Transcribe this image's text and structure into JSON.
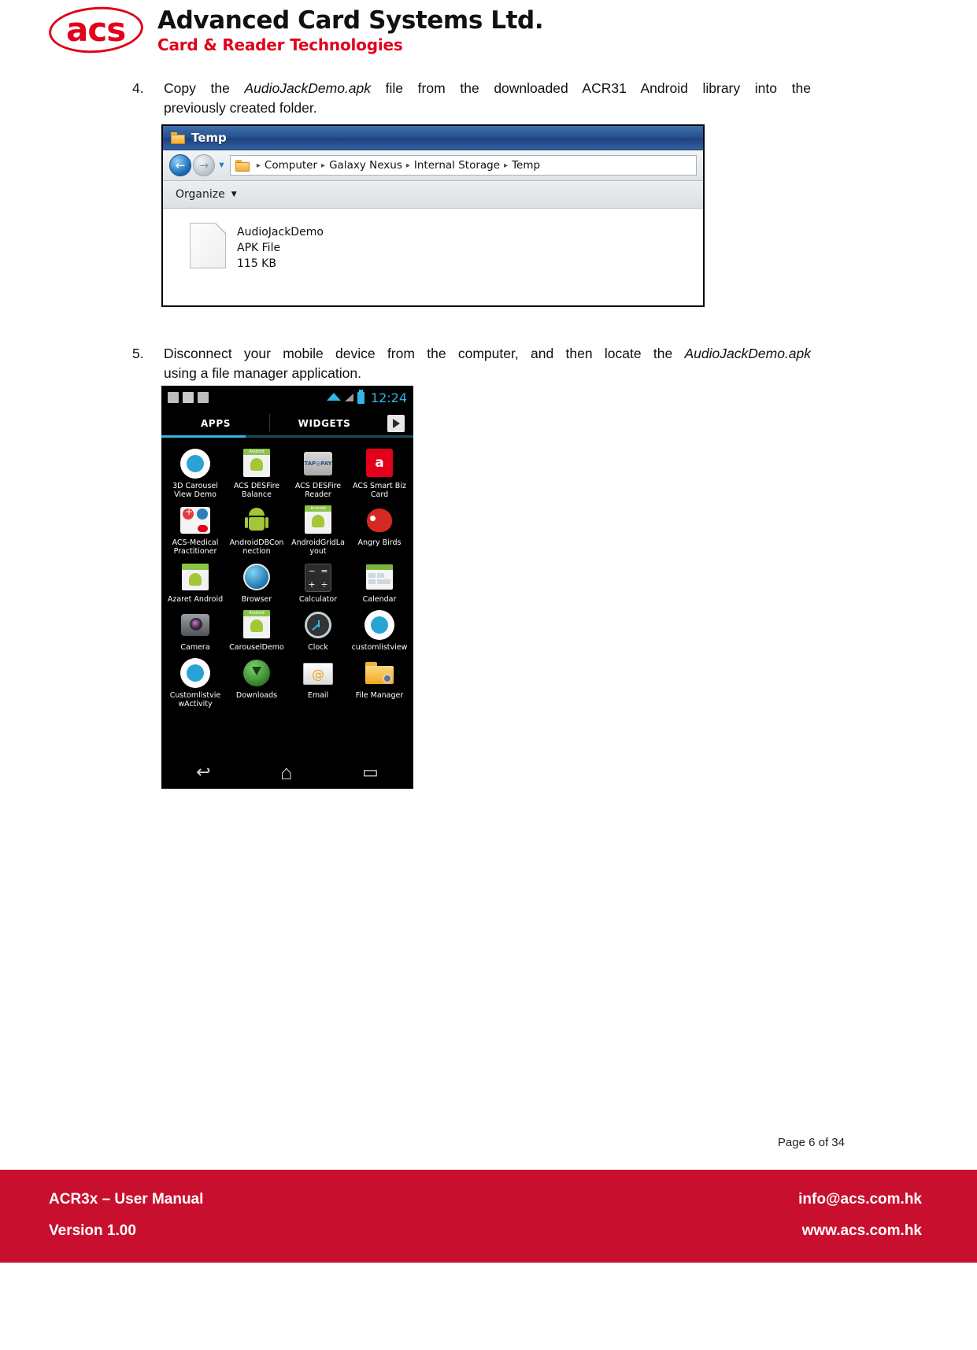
{
  "header": {
    "logo_acs": "acs",
    "company_name": "Advanced Card Systems Ltd.",
    "tagline": "Card & Reader Technologies",
    "brand_color": "#e2001a"
  },
  "steps": [
    {
      "number": "4.",
      "line1_pre": "Copy the ",
      "line1_em": "AudioJackDemo.apk",
      "line1_post": " file from the downloaded ACR31 Android library into the",
      "line2": "previously created folder."
    },
    {
      "number": "5.",
      "line1_pre": "Disconnect your mobile device from the computer, and then locate the ",
      "line1_em": "AudioJackDemo.apk",
      "line1_post": "",
      "line2": "using a file manager application."
    }
  ],
  "explorer": {
    "title": "Temp",
    "title_icon": "folder-icon",
    "back_icon": "back-arrow-icon",
    "forward_icon": "forward-arrow-icon",
    "history_icon": "chevron-down-icon",
    "breadcrumb": [
      "Computer",
      "Galaxy Nexus",
      "Internal Storage",
      "Temp"
    ],
    "breadcrumb_separator": "▸",
    "toolbar": {
      "organize_label": "Organize",
      "caret": "▼"
    },
    "file": {
      "icon": "apk-file-icon",
      "name": "AudioJackDemo",
      "type": "APK File",
      "size": "115 KB"
    }
  },
  "phone": {
    "statusbar": {
      "left_icons": [
        "download-icon",
        "image-icon",
        "play-store-icon"
      ],
      "wifi_icon": "wifi-icon",
      "signal_icon": "signal-icon",
      "battery_icon": "battery-icon",
      "time": "12:24"
    },
    "tabs": [
      {
        "label": "APPS",
        "selected": true
      },
      {
        "label": "WIDGETS",
        "selected": false
      }
    ],
    "shop_icon": "play-store-shop-icon",
    "apps": [
      {
        "label": "3D Carousel View Demo",
        "icon": "carousel-person-icon"
      },
      {
        "label": "ACS DESFire Balance",
        "icon": "android-card-icon"
      },
      {
        "label": "ACS DESFire Reader",
        "icon": "taptopay-icon"
      },
      {
        "label": "ACS Smart Biz Card",
        "icon": "acs-red-icon"
      },
      {
        "label": "ACS-Medical Practitioner",
        "icon": "medical-icon"
      },
      {
        "label": "AndroidDBConnection",
        "icon": "android-robot-icon"
      },
      {
        "label": "AndroidGridLayout",
        "icon": "android-card-icon"
      },
      {
        "label": "Angry Birds",
        "icon": "angry-bird-icon"
      },
      {
        "label": "Azaret Android",
        "icon": "azaret-icon"
      },
      {
        "label": "Browser",
        "icon": "browser-globe-icon"
      },
      {
        "label": "Calculator",
        "icon": "calculator-icon"
      },
      {
        "label": "Calendar",
        "icon": "calendar-icon"
      },
      {
        "label": "Camera",
        "icon": "camera-icon"
      },
      {
        "label": "CarouselDemo",
        "icon": "android-card-icon"
      },
      {
        "label": "Clock",
        "icon": "clock-icon"
      },
      {
        "label": "customlistview",
        "icon": "carousel-person-icon"
      },
      {
        "label": "CustomlistviewActivity",
        "icon": "carousel-person-icon"
      },
      {
        "label": "Downloads",
        "icon": "download-arrow-icon"
      },
      {
        "label": "Email",
        "icon": "email-icon"
      },
      {
        "label": "File Manager",
        "icon": "file-manager-icon"
      }
    ],
    "calculator_keys": [
      "−",
      "=",
      "+",
      "÷"
    ],
    "navbar": {
      "back_icon": "↩",
      "home_icon": "⌂",
      "recents_icon": "▭"
    }
  },
  "footer": {
    "page_label": "Page 6 of 34",
    "manual_title": "ACR3x – User Manual",
    "version": "Version 1.00",
    "email": "info@acs.com.hk",
    "website": "www.acs.com.hk",
    "background_color": "#c8102e"
  }
}
